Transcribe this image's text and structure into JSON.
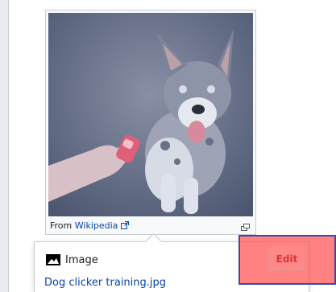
{
  "figure": {
    "caption_prefix": "From",
    "caption_source": "Wikipedia",
    "external_icon": "external-link-icon",
    "magnify_icon": "magnify-icon"
  },
  "popup": {
    "type_label": "Image",
    "type_icon": "image-icon",
    "file_name": "Dog clicker training.jpg"
  },
  "actions": {
    "edit_label": "Edit"
  },
  "colors": {
    "link": "#0645ad",
    "highlight": "#ff5050",
    "highlight_border": "#3a4aa8",
    "edit_text": "#dd3333"
  }
}
